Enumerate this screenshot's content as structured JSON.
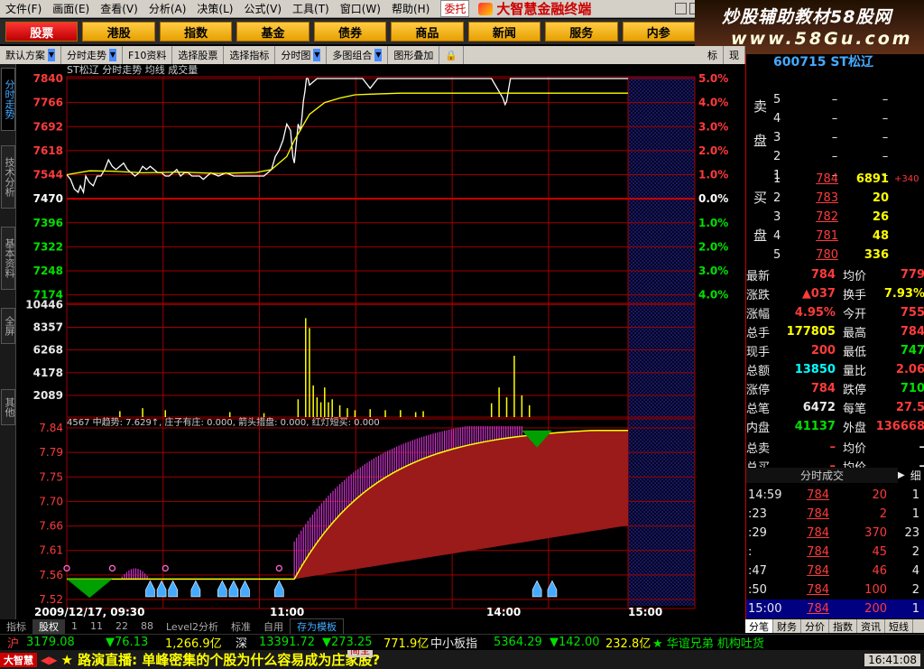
{
  "menu": {
    "items": [
      "文件(F)",
      "画面(E)",
      "查看(V)",
      "分析(A)",
      "决策(L)",
      "公式(V)",
      "工具(T)",
      "窗口(W)",
      "帮助(H)"
    ],
    "entrust": "委托",
    "brand": "大智慧金融终端"
  },
  "banner": {
    "line1": "炒股辅助教材58股网",
    "line2": "www.58Gu.com"
  },
  "nav": {
    "buttons": [
      "股票",
      "港股",
      "指数",
      "基金",
      "债券",
      "商品",
      "新闻",
      "服务",
      "内参"
    ]
  },
  "toolbar": {
    "items": [
      "默认方案",
      "分时走势",
      "F10资料",
      "选择股票",
      "选择指标",
      "分时图",
      "多图组合",
      "图形叠加"
    ],
    "right": [
      "标",
      "现"
    ]
  },
  "leftbar": {
    "tabs": [
      "分时走势",
      "技术分析",
      "基本资料",
      "全屏",
      "其他"
    ]
  },
  "chart": {
    "stock_line": "ST松辽  分时走势  均线  成交量",
    "ind_line": "4567  中趋势: 7.629↑, 庄子有庄: 0.000, 箭头措盘: 0.000, 红灯短买: 0.000",
    "price_left": [
      "7840",
      "7766",
      "7692",
      "7618",
      "7544",
      "7470",
      "7396",
      "7322",
      "7248",
      "7174"
    ],
    "pct_right": [
      "5.0%",
      "4.0%",
      "3.0%",
      "2.0%",
      "1.0%",
      "0.0%",
      "1.0%",
      "2.0%",
      "3.0%",
      "4.0%"
    ],
    "vol_left": [
      "10446",
      "8357",
      "6268",
      "4178",
      "2089"
    ],
    "ind_left": [
      "7.84",
      "7.79",
      "7.75",
      "7.70",
      "7.66",
      "7.61",
      "7.56",
      "7.52"
    ],
    "x_labels": [
      "2009/12/17, 09:30",
      "11:00",
      "14:00",
      "15:00"
    ],
    "colors": {
      "grid": "#a00000",
      "price": "#ffffff",
      "avg": "#ffff00",
      "vol": "#ffff00",
      "magenta": "#cc33cc",
      "darkred": "#9b1a1a",
      "green": "#00a000"
    }
  },
  "chart_data": {
    "type": "line",
    "series": [
      {
        "name": "分时走势",
        "x": [
          0,
          5,
          10,
          15,
          18,
          22,
          25,
          30,
          35,
          40,
          45,
          50,
          55,
          60,
          65,
          70,
          75,
          80,
          85,
          90,
          95,
          100,
          105,
          110,
          115,
          120,
          125,
          130,
          135,
          140,
          145,
          150,
          155,
          160,
          165,
          170,
          175,
          180,
          185,
          190,
          200,
          210,
          220,
          240,
          260,
          270,
          275,
          280,
          285,
          290,
          295,
          298,
          300,
          303,
          305,
          308,
          310,
          312,
          314,
          316,
          318,
          320,
          330,
          350,
          360,
          370,
          380,
          385,
          390,
          400,
          410,
          420,
          440,
          460,
          480,
          500,
          520,
          540,
          560,
          570,
          575,
          578,
          580,
          582,
          585,
          590,
          600,
          610,
          620,
          630,
          640,
          650,
          660,
          670,
          680,
          690,
          700,
          710,
          720,
          730,
          740
        ],
        "values": [
          7544,
          7530,
          7500,
          7490,
          7510,
          7490,
          7540,
          7520,
          7510,
          7540,
          7540,
          7560,
          7590,
          7570,
          7560,
          7570,
          7580,
          7560,
          7550,
          7540,
          7550,
          7570,
          7560,
          7570,
          7560,
          7550,
          7550,
          7540,
          7540,
          7550,
          7560,
          7540,
          7550,
          7550,
          7540,
          7540,
          7540,
          7530,
          7540,
          7550,
          7540,
          7550,
          7540,
          7540,
          7540,
          7560,
          7600,
          7620,
          7650,
          7700,
          7680,
          7600,
          7580,
          7650,
          7700,
          7680,
          7720,
          7770,
          7800,
          7840,
          7840,
          7820,
          7840,
          7840,
          7840,
          7840,
          7840,
          7840,
          7840,
          7810,
          7840,
          7840,
          7840,
          7840,
          7840,
          7840,
          7840,
          7840,
          7840,
          7800,
          7780,
          7760,
          7770,
          7800,
          7840,
          7840,
          7840,
          7840,
          7840,
          7840,
          7840,
          7840,
          7840,
          7840,
          7840,
          7840,
          7840,
          7840,
          7840,
          7840,
          7840
        ]
      },
      {
        "name": "均线",
        "x": [
          0,
          30,
          60,
          100,
          150,
          200,
          250,
          270,
          290,
          300,
          310,
          320,
          340,
          360,
          380,
          400,
          440,
          500,
          560,
          600,
          700,
          740
        ],
        "values": [
          7544,
          7556,
          7555,
          7550,
          7552,
          7548,
          7551,
          7560,
          7600,
          7650,
          7690,
          7730,
          7766,
          7780,
          7790,
          7792,
          7795,
          7795,
          7795,
          7795,
          7795,
          7795
        ]
      }
    ],
    "volume": {
      "x": [
        70,
        100,
        130,
        215,
        260,
        305,
        315,
        320,
        325,
        330,
        335,
        340,
        345,
        350,
        360,
        370,
        380,
        400,
        420,
        440,
        460,
        470,
        560,
        570,
        580,
        590,
        600,
        610
      ],
      "values": [
        600,
        900,
        700,
        500,
        400,
        1800,
        10000,
        9000,
        3200,
        2000,
        1500,
        3000,
        1500,
        1800,
        1200,
        900,
        700,
        800,
        700,
        700,
        500,
        600,
        1400,
        3000,
        2000,
        6200,
        2200,
        1200
      ]
    },
    "y_price_range": [
      7100,
      7840
    ],
    "y_vol_range": [
      0,
      11500
    ],
    "y_ind_range": [
      7.5,
      7.84
    ],
    "x_range": [
      0,
      740
    ]
  },
  "stock_header": "600715 ST松辽",
  "orderbook": {
    "sell": [
      {
        "lv": "5",
        "p": "–",
        "v": "–"
      },
      {
        "lv": "4",
        "p": "–",
        "v": "–"
      },
      {
        "lv": "3",
        "p": "–",
        "v": "–"
      },
      {
        "lv": "2",
        "p": "–",
        "v": "–"
      },
      {
        "lv": "1",
        "p": "–",
        "v": "–"
      }
    ],
    "buy": [
      {
        "lv": "1",
        "p": "784",
        "v": "6891",
        "c": "+340"
      },
      {
        "lv": "2",
        "p": "783",
        "v": "20",
        "c": ""
      },
      {
        "lv": "3",
        "p": "782",
        "v": "26",
        "c": ""
      },
      {
        "lv": "4",
        "p": "781",
        "v": "48",
        "c": ""
      },
      {
        "lv": "5",
        "p": "780",
        "v": "336",
        "c": ""
      }
    ],
    "sell_label": [
      "卖",
      "盘"
    ],
    "buy_label": [
      "买",
      "盘"
    ]
  },
  "quote": [
    {
      "l1": "最新",
      "v1": "784",
      "l2": "均价",
      "v2": "779"
    },
    {
      "l1": "涨跌",
      "v1": "▲037",
      "l2": "换手",
      "v2": "7.93%"
    },
    {
      "l1": "涨幅",
      "v1": "4.95%",
      "l2": "今开",
      "v2": "755"
    },
    {
      "l1": "总手",
      "v1": "177805",
      "l2": "最高",
      "v2": "784"
    },
    {
      "l1": "现手",
      "v1": "200",
      "l2": "最低",
      "v2": "747"
    },
    {
      "l1": "总额",
      "v1": "13850",
      "l2": "量比",
      "v2": "2.06"
    },
    {
      "l1": "涨停",
      "v1": "784",
      "l2": "跌停",
      "v2": "710"
    },
    {
      "l1": "总笔",
      "v1": "6472",
      "l2": "每笔",
      "v2": "27.5"
    },
    {
      "l1": "内盘",
      "v1": "41137",
      "l2": "外盘",
      "v2": "136668"
    },
    {
      "l1": "总卖",
      "v1": "–",
      "l2": "均价",
      "v2": "–"
    },
    {
      "l1": "总买",
      "v1": "–",
      "l2": "均价",
      "v2": "–"
    }
  ],
  "trades_title": "分时成交",
  "trades_detail": "细",
  "trades": [
    {
      "t": "14:59",
      "p": "784",
      "v": "20",
      "n": "1"
    },
    {
      "t": ":23",
      "p": "784",
      "v": "2",
      "n": "1"
    },
    {
      "t": ":29",
      "p": "784",
      "v": "370",
      "n": "23"
    },
    {
      "t": ":",
      "p": "784",
      "v": "45",
      "n": "2"
    },
    {
      "t": ":47",
      "p": "784",
      "v": "46",
      "n": "4"
    },
    {
      "t": ":50",
      "p": "784",
      "v": "100",
      "n": "2"
    },
    {
      "t": "15:00",
      "p": "784",
      "v": "200",
      "n": "1"
    }
  ],
  "bottom_tabs": [
    "指标",
    "股权",
    "1",
    "11",
    "22",
    "88",
    "Level2分析",
    "标准",
    "自用",
    "存为模板"
  ],
  "right_tabs": [
    "分笔",
    "财务",
    "分价",
    "指数",
    "资讯",
    "短线"
  ],
  "index_bar": {
    "sh": "沪",
    "sh_v": "3179.08",
    "sh_c": "▼76.13",
    "sh_amt": "1,266.9亿",
    "sz": "深",
    "sz_v": "13391.72",
    "sz_c": "▼273.25",
    "sz_amt": "771.9亿",
    "zx": "中小板指",
    "zx_v": "5364.29",
    "zx_c": "▼142.00",
    "zx_amt": "232.8亿",
    "news": "★ 华谊兄弟 机构吐货"
  },
  "ticker": {
    "logo": "大智慧",
    "news": "★ 路演直播: 单峰密集的个股为什么容易成为庄家股?",
    "time": "16:41:08",
    "ad": "简全"
  }
}
